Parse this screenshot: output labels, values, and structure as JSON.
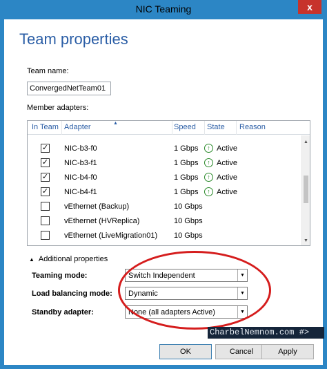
{
  "window": {
    "title": "NIC Teaming",
    "close_glyph": "x"
  },
  "page": {
    "title": "Team properties"
  },
  "team_name": {
    "label": "Team name:",
    "value": "ConvergedNetTeam01"
  },
  "member_adapters": {
    "label": "Member adapters:",
    "columns": [
      "In Team",
      "Adapter",
      "Speed",
      "State",
      "Reason"
    ],
    "rows": [
      {
        "checked": true,
        "check": "✓",
        "adapter": "NIC-b3-f0",
        "speed": "1 Gbps",
        "state": "Active"
      },
      {
        "checked": true,
        "check": "✓",
        "adapter": "NIC-b3-f1",
        "speed": "1 Gbps",
        "state": "Active"
      },
      {
        "checked": true,
        "check": "✓",
        "adapter": "NIC-b4-f0",
        "speed": "1 Gbps",
        "state": "Active"
      },
      {
        "checked": true,
        "check": "✓",
        "adapter": "NIC-b4-f1",
        "speed": "1 Gbps",
        "state": "Active"
      },
      {
        "checked": false,
        "check": "",
        "adapter": "vEthernet (Backup)",
        "speed": "10 Gbps",
        "state": ""
      },
      {
        "checked": false,
        "check": "",
        "adapter": "vEthernet (HVReplica)",
        "speed": "10 Gbps",
        "state": ""
      },
      {
        "checked": false,
        "check": "",
        "adapter": "vEthernet (LiveMigration01)",
        "speed": "10 Gbps",
        "state": ""
      }
    ]
  },
  "additional": {
    "label": "Additional properties",
    "teaming_mode": {
      "label": "Teaming mode:",
      "value": "Switch Independent"
    },
    "load_balancing_mode": {
      "label": "Load balancing mode:",
      "value": "Dynamic"
    },
    "standby_adapter": {
      "label": "Standby adapter:",
      "value": "None (all adapters Active)"
    }
  },
  "watermark": "CharbelNemnom.com #>",
  "buttons": {
    "ok": "OK",
    "cancel": "Cancel",
    "apply": "Apply"
  },
  "colors": {
    "accent": "#2c86c5",
    "title_blue": "#2b5ea6",
    "annotation_red": "#d51d1d",
    "active_green": "#2a8a2a"
  },
  "icons": {
    "state_active": "up-arrow-circle-icon"
  }
}
